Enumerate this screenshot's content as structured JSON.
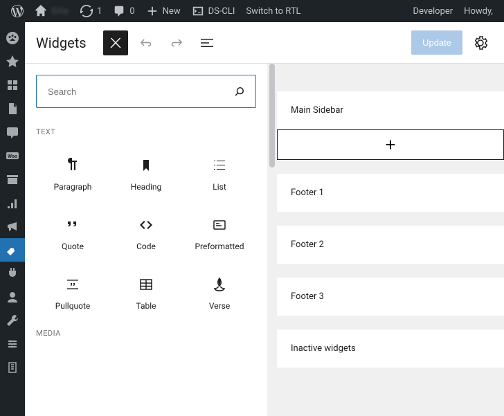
{
  "adminbar": {
    "site_name": "Site",
    "updates_count": "1",
    "comments_count": "0",
    "new_label": "New",
    "dscli_label": "DS-CLI",
    "rtl_label": "Switch to RTL",
    "developer_label": "Developer",
    "howdy_label": "Howdy,"
  },
  "sidemenu": {
    "items": [
      {
        "name": "dashboard-icon"
      },
      {
        "name": "pin-icon"
      },
      {
        "name": "plugins-icon"
      },
      {
        "name": "pages-icon"
      },
      {
        "name": "comments-icon"
      },
      {
        "name": "woo-icon"
      },
      {
        "name": "archive-icon"
      },
      {
        "name": "analytics-icon"
      },
      {
        "name": "marketing-icon"
      },
      {
        "name": "appearance-icon",
        "current": true
      },
      {
        "name": "plugins2-icon"
      },
      {
        "name": "users-icon"
      },
      {
        "name": "tools-icon"
      },
      {
        "name": "settings-icon"
      },
      {
        "name": "custom-icon"
      }
    ]
  },
  "header": {
    "title": "Widgets",
    "update_label": "Update"
  },
  "inserter": {
    "search_placeholder": "Search",
    "categories": [
      {
        "label": "TEXT",
        "blocks": [
          {
            "name": "paragraph",
            "label": "Paragraph"
          },
          {
            "name": "heading",
            "label": "Heading"
          },
          {
            "name": "list",
            "label": "List"
          },
          {
            "name": "quote",
            "label": "Quote"
          },
          {
            "name": "code",
            "label": "Code"
          },
          {
            "name": "preformatted",
            "label": "Preformatted"
          },
          {
            "name": "pullquote",
            "label": "Pullquote"
          },
          {
            "name": "table",
            "label": "Table"
          },
          {
            "name": "verse",
            "label": "Verse"
          }
        ]
      },
      {
        "label": "MEDIA",
        "blocks": []
      }
    ]
  },
  "areas": [
    {
      "label": "Main Sidebar",
      "expanded": true
    },
    {
      "label": "Footer 1",
      "expanded": false
    },
    {
      "label": "Footer 2",
      "expanded": false
    },
    {
      "label": "Footer 3",
      "expanded": false
    },
    {
      "label": "Inactive widgets",
      "expanded": false
    }
  ]
}
